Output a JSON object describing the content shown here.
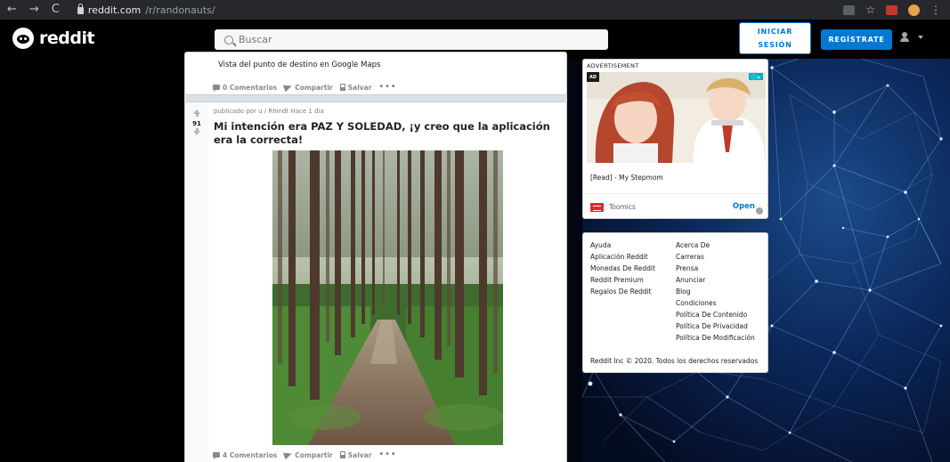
{
  "browser": {
    "url_host": "reddit.com",
    "url_path": "/r/randonauts/"
  },
  "header": {
    "logo_text": "reddit",
    "search_placeholder": "Buscar",
    "login_line1": "INICIAR",
    "login_line2": "SESIÓN",
    "signup_label": "REGÍSTRATE"
  },
  "feed": {
    "post1": {
      "text": "Vista del punto de destino en Google Maps",
      "comments": "0 Comentarios",
      "share": "Compartir",
      "save": "Salvar",
      "more": "•••"
    },
    "post2": {
      "score": "91",
      "meta": "publicado por u / Rhindt Hace 1 día",
      "title": "Mi intención era PAZ Y SOLEDAD, ¡y creo que la aplicación era la correcta!",
      "comments": "4 Comentarios",
      "share": "Compartir",
      "save": "Salvar",
      "more": "•••"
    }
  },
  "ad": {
    "label": "ADVERTISEMENT",
    "corner": "AD",
    "caption": "[Read] - My Stepmom",
    "brand": "Toomics",
    "open": "Open"
  },
  "links": {
    "col_a": [
      "Ayuda",
      "Aplicación Reddit",
      "Monedas De Reddit",
      "Reddit Premium",
      "Regalos De Reddit"
    ],
    "col_b": [
      "Acerca De",
      "Carreras",
      "Prensa",
      "Anunciar",
      "Blog",
      "Condiciones",
      "Política De Contenido",
      "Política De Privacidad",
      "Política De Modificación"
    ],
    "copyright": "Reddit Inc © 2020. Todos los derechos reservados"
  },
  "colors": {
    "accent": "#0079d3",
    "header_bg": "#000000",
    "feed_bg": "#dae0e6",
    "network_bg": "#06163a"
  }
}
